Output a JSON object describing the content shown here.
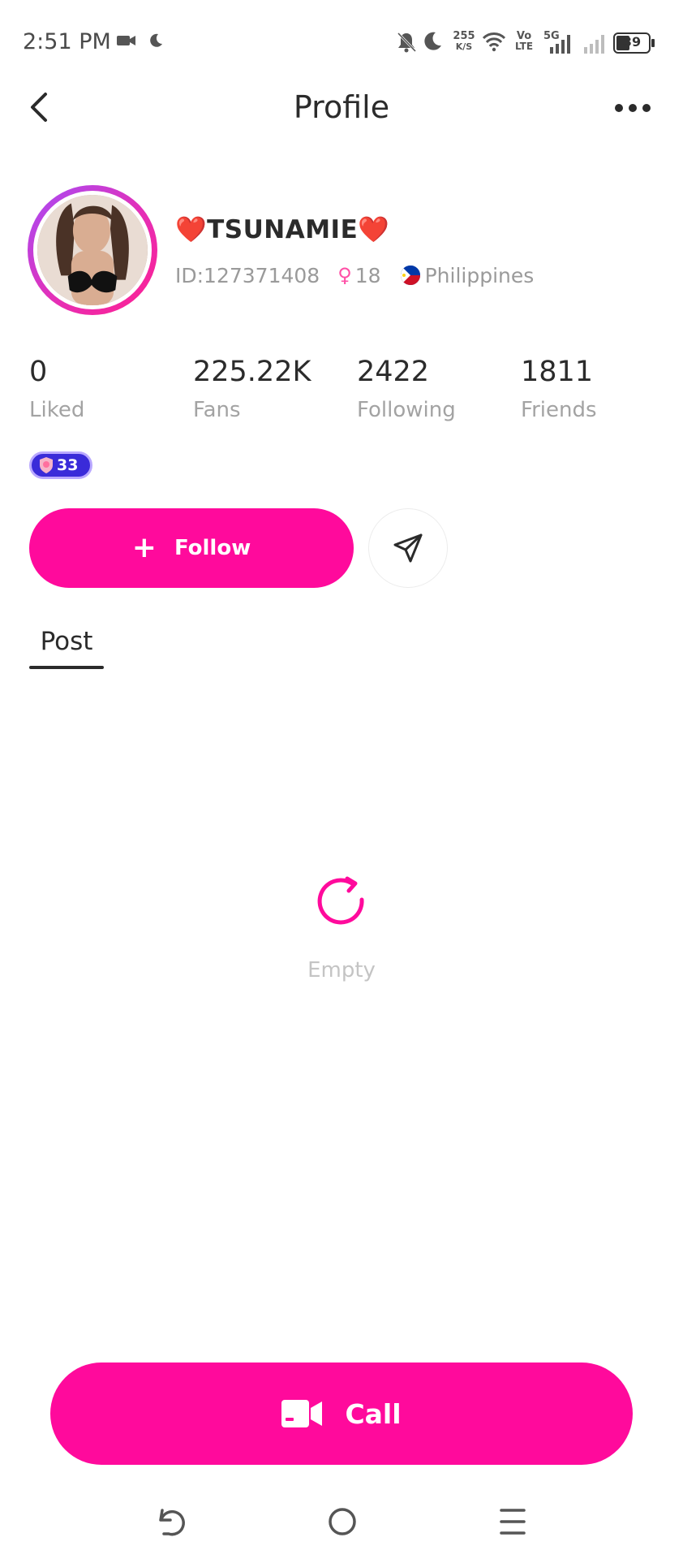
{
  "status_bar": {
    "time": "2:51 PM",
    "net_speed_value": "255",
    "net_speed_unit": "K/S",
    "volte_top": "Vo",
    "volte_bottom": "LTE",
    "network": "5G",
    "battery": "39",
    "icons": [
      "video-camera-icon",
      "moon-icon",
      "bell-off-icon",
      "moon-icon",
      "wifi-icon",
      "signal-icon",
      "signal-icon",
      "battery-icon"
    ]
  },
  "header": {
    "title": "Profile",
    "back_icon": "chevron-left-icon",
    "more_icon": "more-horizontal-icon"
  },
  "profile": {
    "heart_left": "❤️",
    "name": "TSUNAMIE",
    "heart_right": "❤️",
    "id": "ID:127371408",
    "gender_symbol": "♀",
    "age": "18",
    "country": "Philippines"
  },
  "stats": [
    {
      "value": "0",
      "label": "Liked"
    },
    {
      "value": "225.22K",
      "label": "Fans"
    },
    {
      "value": "2422",
      "label": "Following"
    },
    {
      "value": "1811",
      "label": "Friends"
    }
  ],
  "level_badge": {
    "value": "33"
  },
  "actions": {
    "follow_icon": "+",
    "follow_label": "Follow",
    "message_icon": "send-icon"
  },
  "tabs": [
    {
      "label": "Post",
      "active": true
    }
  ],
  "empty_state": {
    "icon": "refresh-icon",
    "text": "Empty"
  },
  "call_button": {
    "icon": "video-camera-icon",
    "label": "Call"
  },
  "nav_bar": {
    "items": [
      "back-nav-icon",
      "home-nav-icon",
      "menu-nav-icon"
    ]
  },
  "colors": {
    "accent": "#ff0a9c",
    "text_primary": "#2b2b2b",
    "text_secondary": "#a3a3a3",
    "badge": "#3a2bd9"
  }
}
